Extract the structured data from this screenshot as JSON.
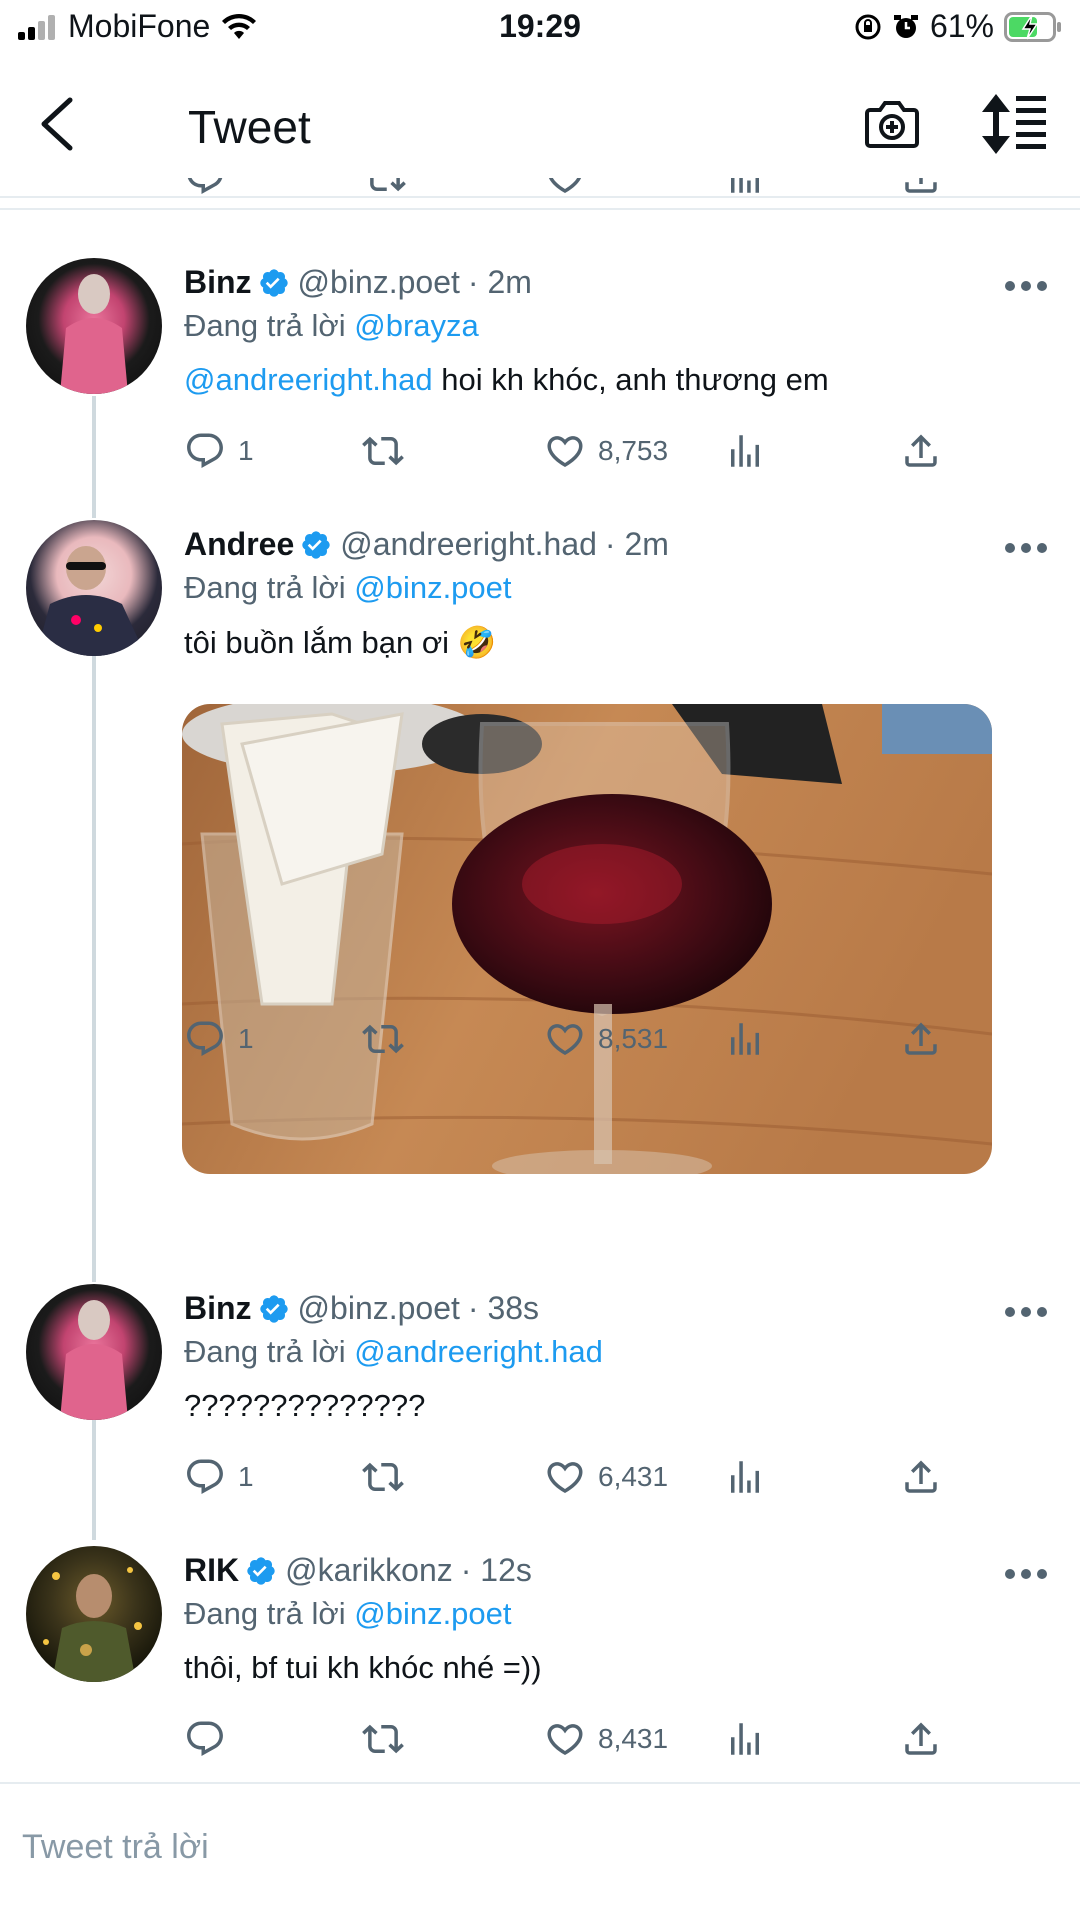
{
  "status_bar": {
    "carrier": "MobiFone",
    "time": "19:29",
    "battery": "61%"
  },
  "nav": {
    "title": "Tweet",
    "back_icon": "chevron-left-icon",
    "camera_icon": "camera-plus-icon",
    "sort_icon": "sort-list-icon"
  },
  "tweets": [
    {
      "name": "Binz",
      "handle": "@binz.poet",
      "time": "· 2m",
      "reply_prefix": "Đang trả lời ",
      "reply_to": "@brayza",
      "mention": "@andreeright.had",
      "text": " hoi kh khóc, anh thương em",
      "replies": "1",
      "likes": "8,753"
    },
    {
      "name": "Andree",
      "handle": "@andreeright.had",
      "time": "· 2m",
      "reply_prefix": "Đang trả lời ",
      "reply_to": "@binz.poet",
      "text": "tôi buồn lắm bạn ơi 🤣",
      "replies": "1",
      "likes": "8,531"
    },
    {
      "name": "Binz",
      "handle": "@binz.poet",
      "time": "· 38s",
      "reply_prefix": "Đang trả lời ",
      "reply_to": "@andreeright.had",
      "text": "??????????????",
      "replies": "1",
      "likes": "6,431"
    },
    {
      "name": "RIK",
      "handle": "@karikkonz",
      "time": "· 12s",
      "reply_prefix": "Đang trả lời ",
      "reply_to": "@binz.poet",
      "text": "thôi, bf tui kh khóc nhé =))",
      "replies": "",
      "likes": "8,431"
    }
  ],
  "reply_box": {
    "placeholder": "Tweet trả lời"
  },
  "colors": {
    "link": "#1d9bf0",
    "secondary": "#536471",
    "verified": "#1d9bf0",
    "divider": "#e6ecf0"
  }
}
